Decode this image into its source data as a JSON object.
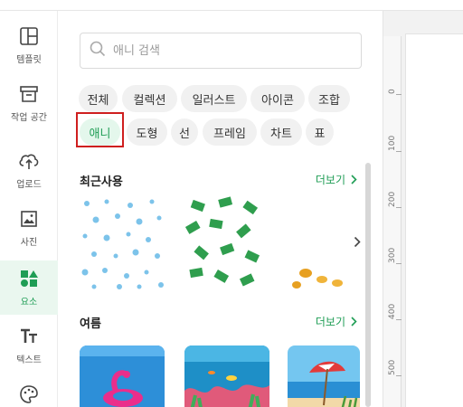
{
  "sidebar": {
    "items": [
      {
        "label": "템플릿",
        "icon": "template-icon"
      },
      {
        "label": "작업 공간",
        "icon": "workspace-icon"
      },
      {
        "label": "업로드",
        "icon": "upload-icon"
      },
      {
        "label": "사진",
        "icon": "photo-icon"
      },
      {
        "label": "요소",
        "icon": "elements-icon"
      },
      {
        "label": "텍스트",
        "icon": "text-icon"
      },
      {
        "label": "",
        "icon": "palette-icon"
      }
    ]
  },
  "search": {
    "placeholder": "애니 검색"
  },
  "chips": {
    "row1": [
      "전체",
      "컬렉션",
      "일러스트",
      "아이콘",
      "조합"
    ],
    "row2": [
      "애니",
      "도형",
      "선",
      "프레임",
      "차트",
      "표"
    ],
    "selected": "애니"
  },
  "sections": {
    "recent": {
      "title": "최근사용",
      "more": "더보기"
    },
    "summer": {
      "title": "여름",
      "more": "더보기"
    }
  },
  "ruler": {
    "ticks": [
      "0",
      "100",
      "200",
      "300",
      "400",
      "500"
    ]
  },
  "colors": {
    "accent": "#1f9d55",
    "highlight": "#cf1f1f"
  }
}
